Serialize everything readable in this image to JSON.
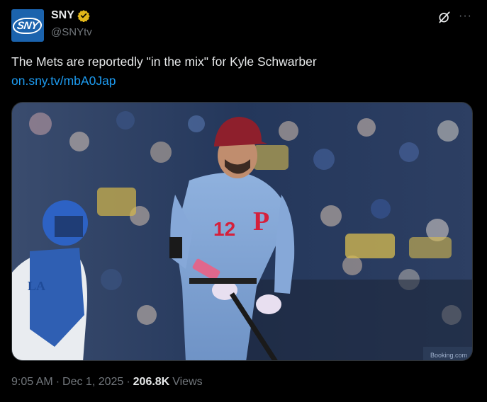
{
  "account": {
    "display_name": "SNY",
    "handle": "@SNYtv",
    "avatar_text": "SNY"
  },
  "tweet": {
    "text": "The Mets are reportedly \"in the mix\" for Kyle Schwarber",
    "link": "on.sny.tv/mbA0Jap"
  },
  "media": {
    "jersey_number": "12",
    "sign_text": "Booking.com"
  },
  "meta": {
    "time": "9:05 AM",
    "separator": "·",
    "date": "Dec 1, 2025",
    "separator2": "·",
    "views_count": "206.8K",
    "views_label": "Views"
  },
  "icons": {
    "verified": "verified-badge-icon",
    "grok": "grok-icon",
    "more": "more-options-icon"
  },
  "colors": {
    "background": "#000000",
    "text": "#e7e9ea",
    "muted": "#71767b",
    "link": "#1d9bf0",
    "verified": "#e2b719",
    "avatar": "#1b63ad"
  }
}
